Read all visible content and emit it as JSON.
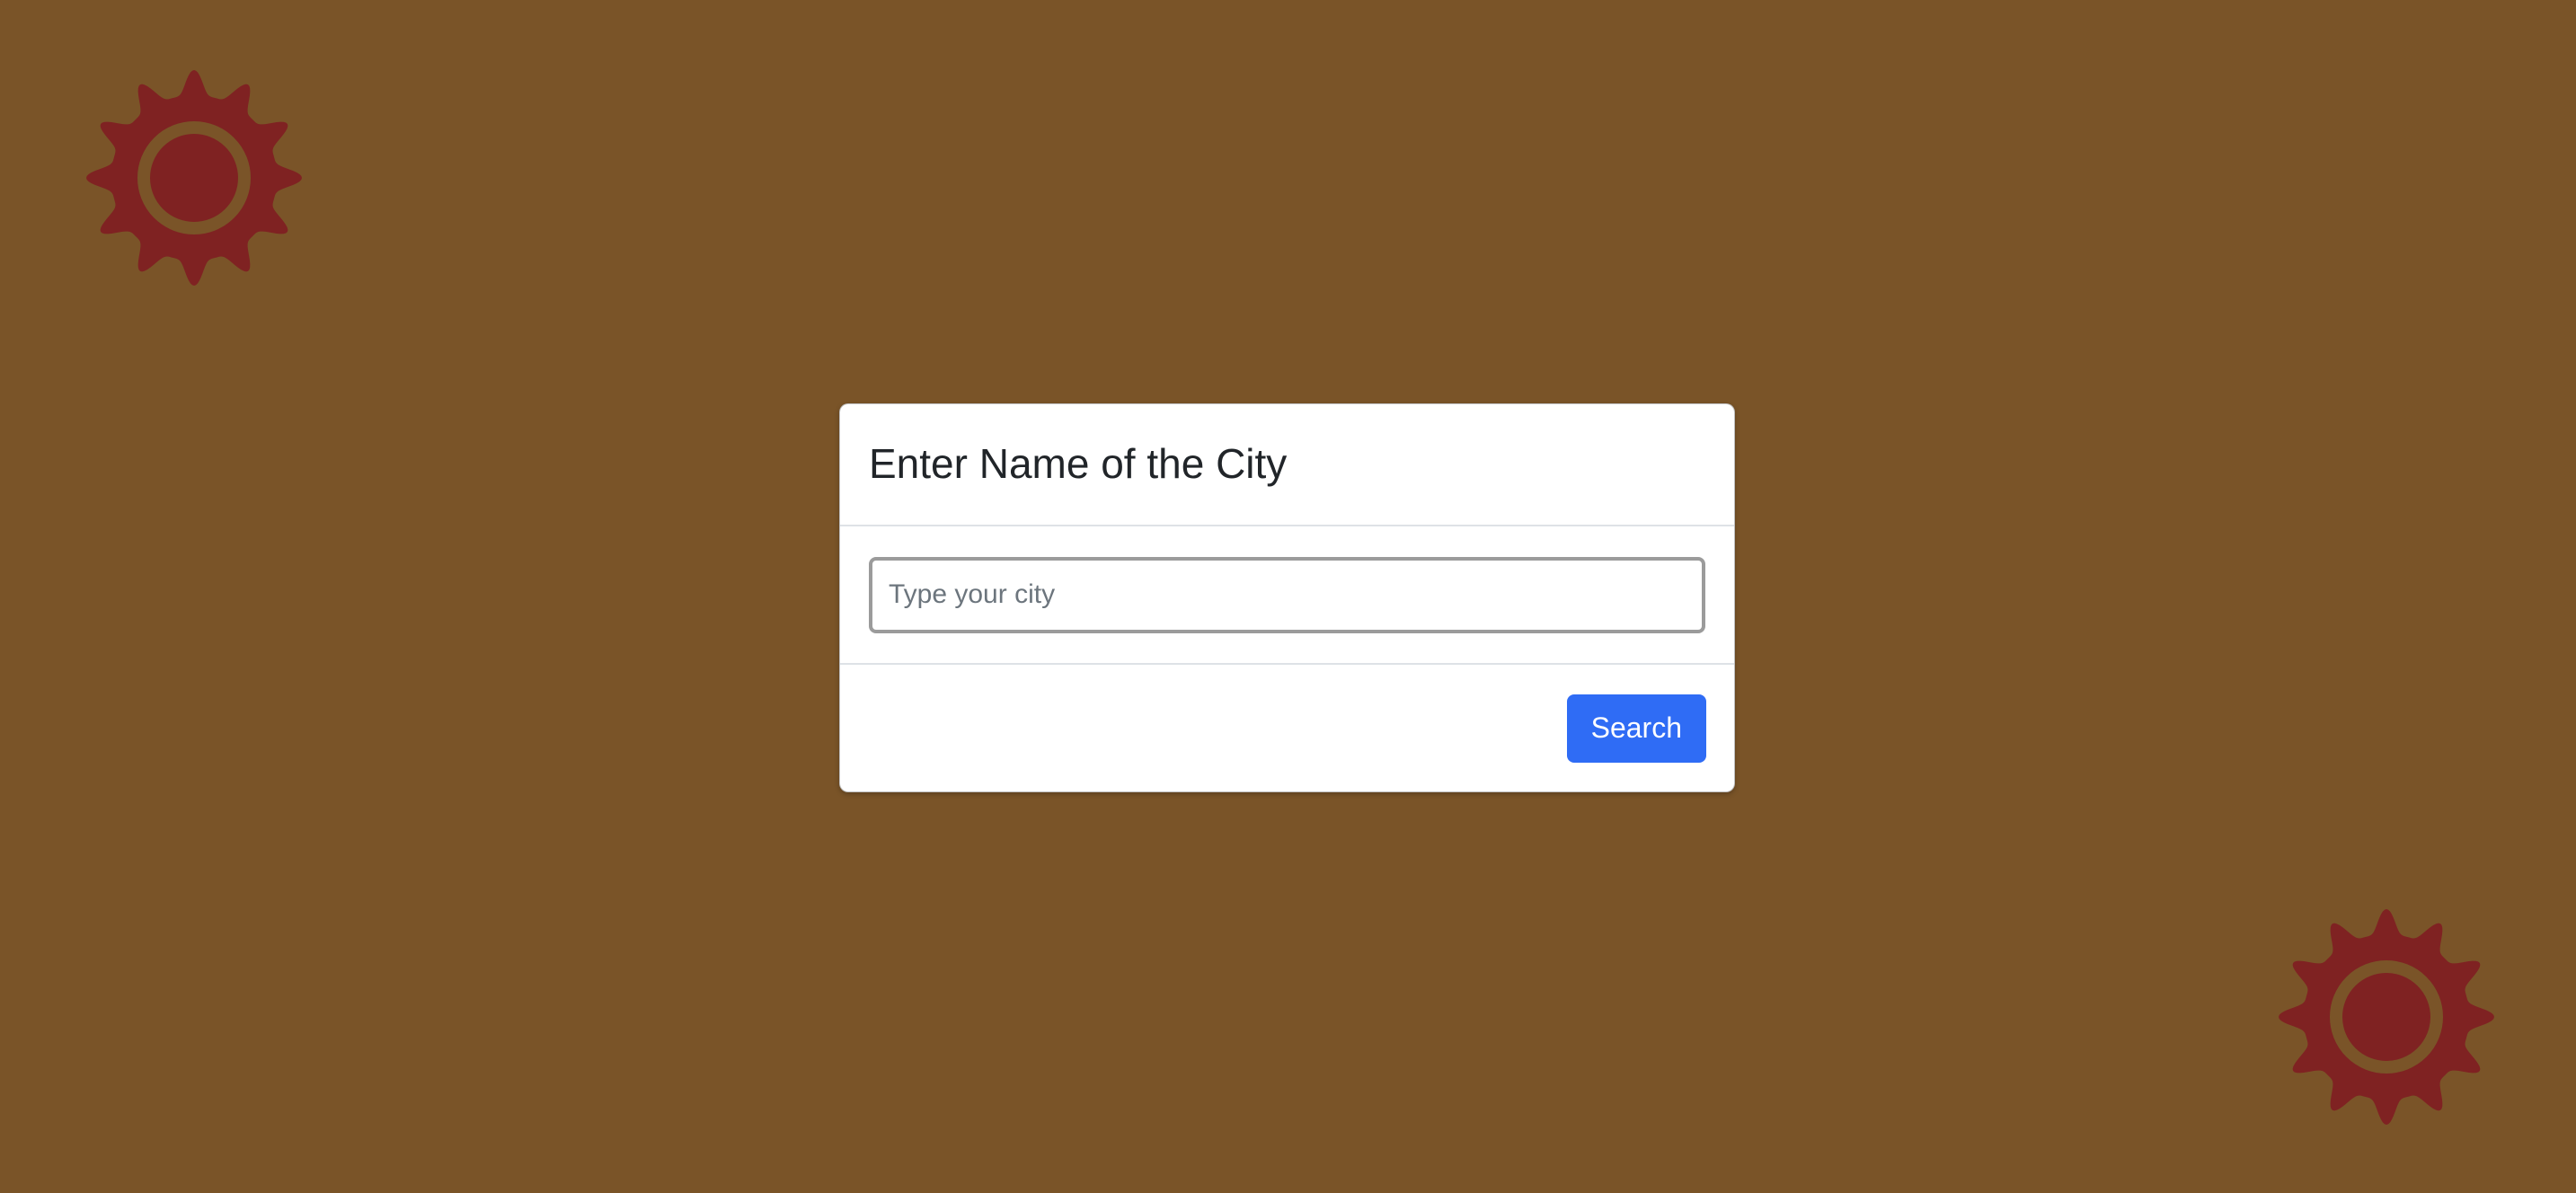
{
  "theme": {
    "background": "#7a5428",
    "sun_color": "#7f2222",
    "accent": "#2f6cf5"
  },
  "decorations": {
    "top_icon": "sun-icon",
    "bottom_icon": "sun-icon"
  },
  "modal": {
    "title": "Enter Name of the City",
    "input": {
      "placeholder": "Type your city",
      "value": ""
    },
    "search_label": "Search"
  }
}
